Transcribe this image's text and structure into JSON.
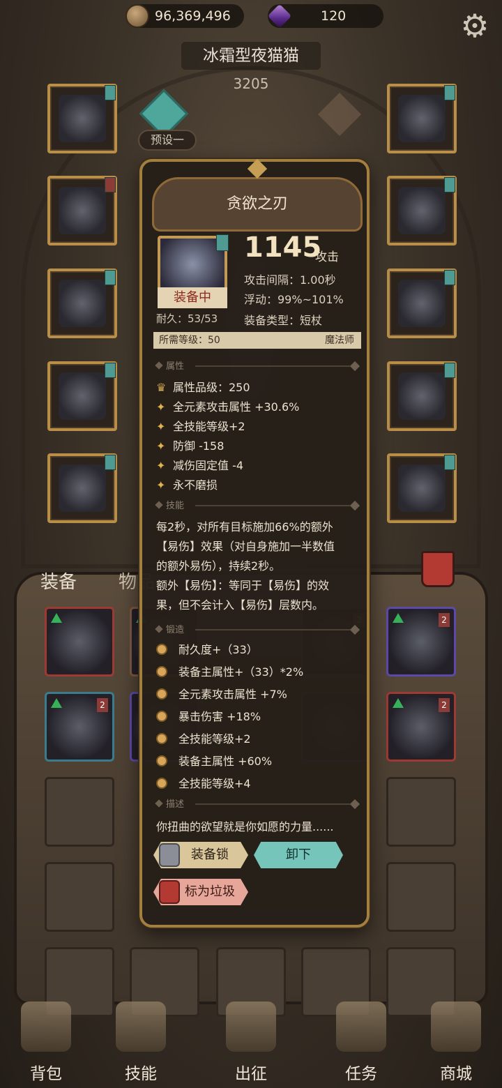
{
  "currency": {
    "coins": "96,369,496",
    "gems": "120"
  },
  "hero": {
    "name": "冰霜型夜猫猫",
    "score": "3205",
    "preset": "预设一"
  },
  "tabs": {
    "equip": "装备",
    "items": "物品"
  },
  "tooltip": {
    "title": "贪欲之刃",
    "equipped_label": "装备中",
    "durability": "耐久：53/53",
    "attack_value": "1145",
    "attack_unit": "攻击",
    "stats": [
      "攻击间隔：1.00秒",
      "浮动：99%~101%",
      "装备类型：短杖"
    ],
    "required_level": "所需等级：50",
    "required_class": "魔法师",
    "section_attributes": "属性",
    "attribute_grade": "属性品级：250",
    "attributes": [
      "全元素攻击属性 +30.6%",
      "全技能等级+2",
      "防御 -158",
      "减伤固定值 -4",
      "永不磨损"
    ],
    "section_skill": "技能",
    "skill_lines": [
      "每2秒，对所有目标施加66%的额外",
      "【易伤】效果（对自身施加一半数值",
      "的额外易伤），持续2秒。",
      "额外【易伤】：等同于【易伤】的效",
      "果，但不会计入【易伤】层数内。"
    ],
    "section_forge": "锻造",
    "forge": [
      "耐久度+（33）",
      "装备主属性+（33）*2%",
      "全元素攻击属性 +7%",
      "暴击伤害 +18%",
      "全技能等级+2",
      "装备主属性 +60%",
      "全技能等级+4"
    ],
    "section_desc": "描述",
    "description": "你扭曲的欲望就是你如愿的力量......",
    "buttons": {
      "lock": "装备锁",
      "unequip": "卸下",
      "junk": "标为垃圾"
    }
  },
  "nav": [
    "背包",
    "技能",
    "出征",
    "任务",
    "商城"
  ],
  "icons": {
    "settings": "gear-icon",
    "coin": "coin-icon",
    "gem": "gem-icon",
    "trash": "trash-icon"
  },
  "colors": {
    "gold_frame": "#b88e49",
    "teal_tag": "#4f9a92",
    "panel": "#261f19"
  }
}
